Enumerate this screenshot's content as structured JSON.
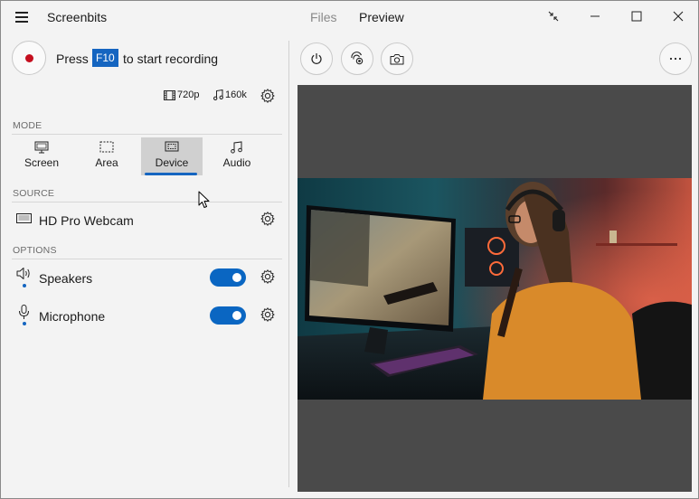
{
  "app": {
    "title": "Screenbits"
  },
  "nav": {
    "files": "Files",
    "preview": "Preview"
  },
  "recording": {
    "press": "Press",
    "key": "F10",
    "suffix": "to start recording"
  },
  "quality": {
    "video": "720p",
    "audio": "160k"
  },
  "sections": {
    "mode": "MODE",
    "source": "SOURCE",
    "options": "OPTIONS"
  },
  "modes": [
    {
      "label": "Screen",
      "icon": "screen-icon",
      "selected": false
    },
    {
      "label": "Area",
      "icon": "area-icon",
      "selected": false
    },
    {
      "label": "Device",
      "icon": "device-icon",
      "selected": true
    },
    {
      "label": "Audio",
      "icon": "audio-note-icon",
      "selected": false
    }
  ],
  "source": {
    "name": "HD Pro Webcam"
  },
  "options": [
    {
      "label": "Speakers",
      "enabled": true
    },
    {
      "label": "Microphone",
      "enabled": true
    }
  ],
  "colors": {
    "accent": "#1565c0",
    "record": "#c50f1f",
    "toggle_on": "#0a66c2",
    "preview_bg": "#4a4a4a"
  }
}
